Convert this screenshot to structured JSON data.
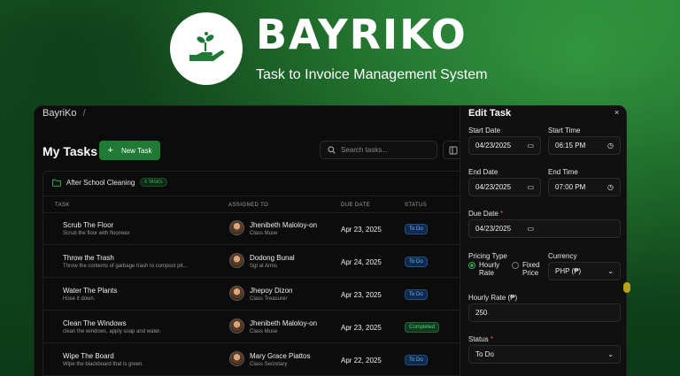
{
  "hero": {
    "brand": "BAYRIKO",
    "tagline": "Task to Invoice Management System"
  },
  "app": {
    "breadcrumb_home": "BayriKo",
    "breadcrumb_sep": "/",
    "page_title": "My Tasks",
    "new_task_label": "New Task",
    "new_task_icon": "+",
    "search_placeholder": "Search tasks...",
    "group": {
      "name": "After School Cleaning",
      "count": "6 TASKS"
    },
    "columns": [
      "TASK",
      "ASSIGNED TO",
      "DUE DATE",
      "STATUS"
    ],
    "tasks": [
      {
        "name": "Scrub The Floor",
        "desc": "Scrub the floor with floorwax",
        "assignee": "Jhenibeth Maloloy-on",
        "role": "Class Muse",
        "due": "Apr 23, 2025",
        "status": "To Do",
        "status_kind": "todo"
      },
      {
        "name": "Throw the Trash",
        "desc": "Throw the contents of garbage trash to compost pit...",
        "assignee": "Dodong Bunal",
        "role": "Sgt at Arms",
        "due": "Apr 24, 2025",
        "status": "To Do",
        "status_kind": "todo"
      },
      {
        "name": "Water The Plants",
        "desc": "Hose it down.",
        "assignee": "Jhepoy Dizon",
        "role": "Class Treasurer",
        "due": "Apr 23, 2025",
        "status": "To Do",
        "status_kind": "todo"
      },
      {
        "name": "Clean The Windows",
        "desc": "clean the windows, apply soap and water.",
        "assignee": "Jhenibeth Maloloy-on",
        "role": "Class Muse",
        "due": "Apr 23, 2025",
        "status": "Completed",
        "status_kind": "done"
      },
      {
        "name": "Wipe The Board",
        "desc": "Wipe the blackboard that is green.",
        "assignee": "Mary Grace Piattos",
        "role": "Class Secretary",
        "due": "Apr 22, 2025",
        "status": "To Do",
        "status_kind": "todo"
      }
    ]
  },
  "edit": {
    "title": "Edit Task",
    "close": "×",
    "start_date_label": "Start Date",
    "start_date": "04/23/2025",
    "start_time_label": "Start Time",
    "start_time": "06:15 PM",
    "end_date_label": "End Date",
    "end_date": "04/23/2025",
    "end_time_label": "End Time",
    "end_time": "07:00 PM",
    "due_date_label": "Due Date",
    "due_date": "04/23/2025",
    "required_mark": "*",
    "pricing_type_label": "Pricing Type",
    "pricing_option_hourly": "Hourly Rate",
    "pricing_option_fixed": "Fixed Price",
    "pricing_selected": "hourly",
    "currency_label": "Currency",
    "currency": "PHP (₱)",
    "hourly_rate_label": "Hourly Rate (₱)",
    "hourly_rate": "250",
    "status_label": "Status",
    "status": "To Do"
  },
  "colors": {
    "accent": "#1e7a34",
    "todo": "#6cb0ff",
    "completed": "#57d27a"
  }
}
